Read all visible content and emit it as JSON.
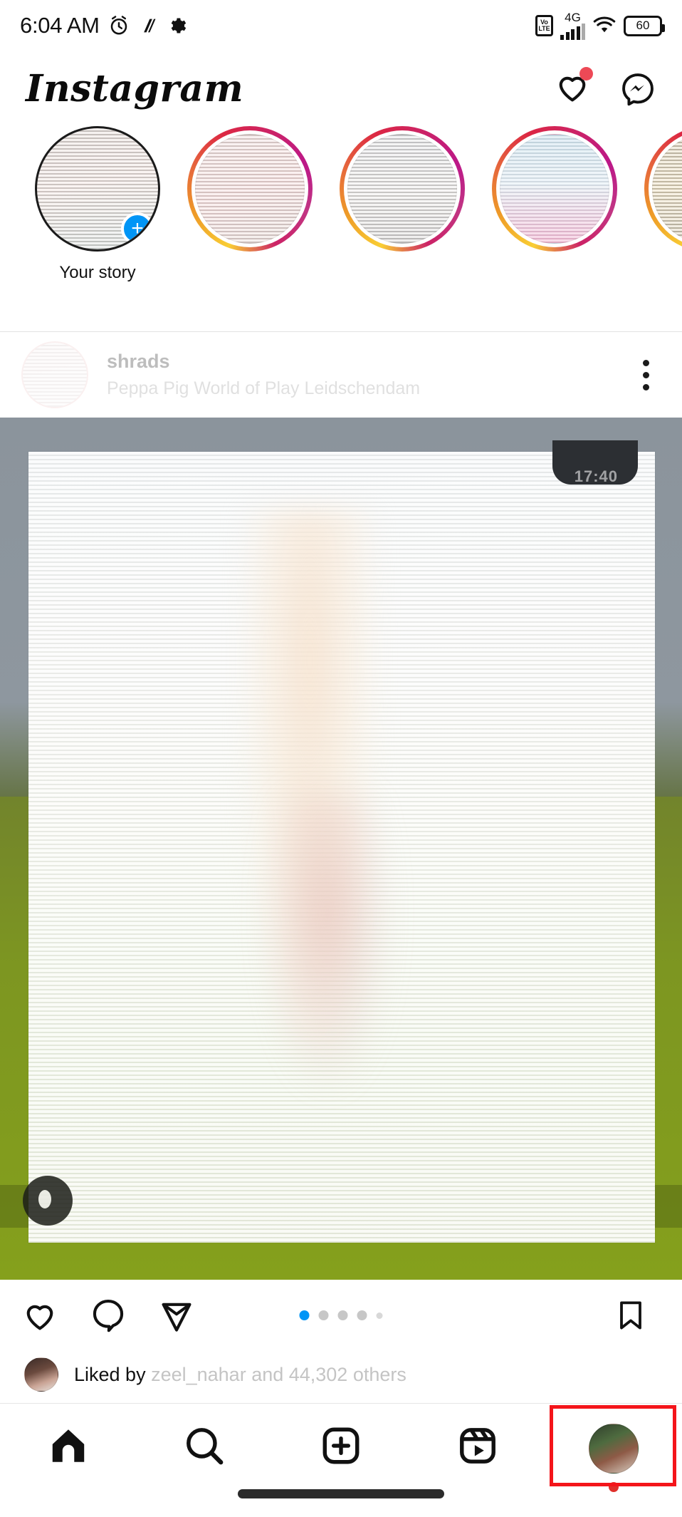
{
  "status_bar": {
    "time": "6:04 AM",
    "icons_left": [
      "alarm-clock-icon",
      "app-badge-icon",
      "gear-icon"
    ],
    "network_type": "4G",
    "volte_top": "Vo",
    "volte_bottom": "LTE",
    "battery_level": "60",
    "icons_right": [
      "volte-icon",
      "signal-bars-icon",
      "wifi-icon",
      "battery-icon"
    ]
  },
  "app_header": {
    "logo": "Instagram",
    "actions": [
      {
        "name": "notifications-heart-icon",
        "has_badge": true
      },
      {
        "name": "messenger-icon",
        "has_badge": false
      }
    ]
  },
  "stories": {
    "items": [
      {
        "label": "Your story",
        "has_gradient_ring": false,
        "has_add_badge": true,
        "pic": "pic-a"
      },
      {
        "label": "",
        "has_gradient_ring": true,
        "has_add_badge": false,
        "pic": "pic-b"
      },
      {
        "label": "",
        "has_gradient_ring": true,
        "has_add_badge": false,
        "pic": "pic-c"
      },
      {
        "label": "",
        "has_gradient_ring": true,
        "has_add_badge": false,
        "pic": "pic-d"
      },
      {
        "label": "",
        "has_gradient_ring": true,
        "has_add_badge": false,
        "pic": "pic-e"
      }
    ]
  },
  "post": {
    "username": "shrads",
    "location": "Peppa Pig World of Play Leidschendam",
    "more_menu": "more-options-icon",
    "media_badge": "17:40",
    "carousel": {
      "total": 5,
      "active_index": 0
    },
    "actions": {
      "like": "like-heart-icon",
      "comment": "comment-bubble-icon",
      "share": "share-paperplane-icon",
      "save": "save-bookmark-icon"
    },
    "likes_text_prefix": "Liked by ",
    "likes_user": "zeel_nahar",
    "likes_text_suffix": " and 44,302 others"
  },
  "bottom_nav": {
    "items": [
      {
        "name": "nav-home",
        "icon": "home-icon",
        "active": true
      },
      {
        "name": "nav-search",
        "icon": "search-icon",
        "active": false
      },
      {
        "name": "nav-create",
        "icon": "plus-square-icon",
        "active": false
      },
      {
        "name": "nav-reels",
        "icon": "reels-icon",
        "active": false
      },
      {
        "name": "nav-profile",
        "icon": "profile-avatar-icon",
        "active": false,
        "has_red_dot": true,
        "highlighted": true
      }
    ]
  },
  "colors": {
    "accent_blue": "#0095F6",
    "notification_red": "#ED4956",
    "highlight_red": "#F4151A",
    "story_gradient_start": "#F9CE34",
    "story_gradient_end": "#BC1888"
  }
}
